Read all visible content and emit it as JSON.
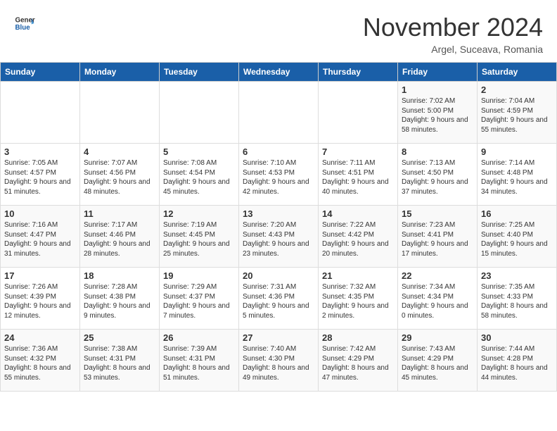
{
  "header": {
    "logo_general": "General",
    "logo_blue": "Blue",
    "month_title": "November 2024",
    "location": "Argel, Suceava, Romania"
  },
  "calendar": {
    "headers": [
      "Sunday",
      "Monday",
      "Tuesday",
      "Wednesday",
      "Thursday",
      "Friday",
      "Saturday"
    ],
    "weeks": [
      [
        {
          "day": "",
          "info": ""
        },
        {
          "day": "",
          "info": ""
        },
        {
          "day": "",
          "info": ""
        },
        {
          "day": "",
          "info": ""
        },
        {
          "day": "",
          "info": ""
        },
        {
          "day": "1",
          "info": "Sunrise: 7:02 AM\nSunset: 5:00 PM\nDaylight: 9 hours and 58 minutes."
        },
        {
          "day": "2",
          "info": "Sunrise: 7:04 AM\nSunset: 4:59 PM\nDaylight: 9 hours and 55 minutes."
        }
      ],
      [
        {
          "day": "3",
          "info": "Sunrise: 7:05 AM\nSunset: 4:57 PM\nDaylight: 9 hours and 51 minutes."
        },
        {
          "day": "4",
          "info": "Sunrise: 7:07 AM\nSunset: 4:56 PM\nDaylight: 9 hours and 48 minutes."
        },
        {
          "day": "5",
          "info": "Sunrise: 7:08 AM\nSunset: 4:54 PM\nDaylight: 9 hours and 45 minutes."
        },
        {
          "day": "6",
          "info": "Sunrise: 7:10 AM\nSunset: 4:53 PM\nDaylight: 9 hours and 42 minutes."
        },
        {
          "day": "7",
          "info": "Sunrise: 7:11 AM\nSunset: 4:51 PM\nDaylight: 9 hours and 40 minutes."
        },
        {
          "day": "8",
          "info": "Sunrise: 7:13 AM\nSunset: 4:50 PM\nDaylight: 9 hours and 37 minutes."
        },
        {
          "day": "9",
          "info": "Sunrise: 7:14 AM\nSunset: 4:48 PM\nDaylight: 9 hours and 34 minutes."
        }
      ],
      [
        {
          "day": "10",
          "info": "Sunrise: 7:16 AM\nSunset: 4:47 PM\nDaylight: 9 hours and 31 minutes."
        },
        {
          "day": "11",
          "info": "Sunrise: 7:17 AM\nSunset: 4:46 PM\nDaylight: 9 hours and 28 minutes."
        },
        {
          "day": "12",
          "info": "Sunrise: 7:19 AM\nSunset: 4:45 PM\nDaylight: 9 hours and 25 minutes."
        },
        {
          "day": "13",
          "info": "Sunrise: 7:20 AM\nSunset: 4:43 PM\nDaylight: 9 hours and 23 minutes."
        },
        {
          "day": "14",
          "info": "Sunrise: 7:22 AM\nSunset: 4:42 PM\nDaylight: 9 hours and 20 minutes."
        },
        {
          "day": "15",
          "info": "Sunrise: 7:23 AM\nSunset: 4:41 PM\nDaylight: 9 hours and 17 minutes."
        },
        {
          "day": "16",
          "info": "Sunrise: 7:25 AM\nSunset: 4:40 PM\nDaylight: 9 hours and 15 minutes."
        }
      ],
      [
        {
          "day": "17",
          "info": "Sunrise: 7:26 AM\nSunset: 4:39 PM\nDaylight: 9 hours and 12 minutes."
        },
        {
          "day": "18",
          "info": "Sunrise: 7:28 AM\nSunset: 4:38 PM\nDaylight: 9 hours and 9 minutes."
        },
        {
          "day": "19",
          "info": "Sunrise: 7:29 AM\nSunset: 4:37 PM\nDaylight: 9 hours and 7 minutes."
        },
        {
          "day": "20",
          "info": "Sunrise: 7:31 AM\nSunset: 4:36 PM\nDaylight: 9 hours and 5 minutes."
        },
        {
          "day": "21",
          "info": "Sunrise: 7:32 AM\nSunset: 4:35 PM\nDaylight: 9 hours and 2 minutes."
        },
        {
          "day": "22",
          "info": "Sunrise: 7:34 AM\nSunset: 4:34 PM\nDaylight: 9 hours and 0 minutes."
        },
        {
          "day": "23",
          "info": "Sunrise: 7:35 AM\nSunset: 4:33 PM\nDaylight: 8 hours and 58 minutes."
        }
      ],
      [
        {
          "day": "24",
          "info": "Sunrise: 7:36 AM\nSunset: 4:32 PM\nDaylight: 8 hours and 55 minutes."
        },
        {
          "day": "25",
          "info": "Sunrise: 7:38 AM\nSunset: 4:31 PM\nDaylight: 8 hours and 53 minutes."
        },
        {
          "day": "26",
          "info": "Sunrise: 7:39 AM\nSunset: 4:31 PM\nDaylight: 8 hours and 51 minutes."
        },
        {
          "day": "27",
          "info": "Sunrise: 7:40 AM\nSunset: 4:30 PM\nDaylight: 8 hours and 49 minutes."
        },
        {
          "day": "28",
          "info": "Sunrise: 7:42 AM\nSunset: 4:29 PM\nDaylight: 8 hours and 47 minutes."
        },
        {
          "day": "29",
          "info": "Sunrise: 7:43 AM\nSunset: 4:29 PM\nDaylight: 8 hours and 45 minutes."
        },
        {
          "day": "30",
          "info": "Sunrise: 7:44 AM\nSunset: 4:28 PM\nDaylight: 8 hours and 44 minutes."
        }
      ]
    ]
  }
}
